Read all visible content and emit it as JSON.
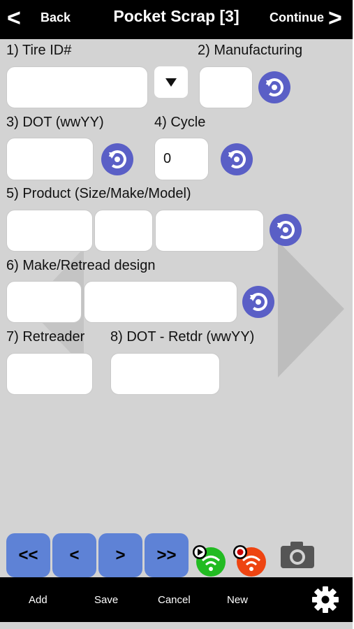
{
  "header": {
    "back_label": "Back",
    "title": "Pocket Scrap [3]",
    "continue_label": "Continue"
  },
  "form": {
    "tire_id_label": "1) Tire ID#",
    "tire_id_value": "",
    "manufacturing_label": "2) Manufacturing",
    "manufacturing_value": "",
    "dot_label": "3) DOT (wwYY)",
    "dot_value": "",
    "cycle_label": "4) Cycle",
    "cycle_value": "0",
    "product_label": "5) Product (Size/Make/Model)",
    "product_size_value": "",
    "product_make_value": "",
    "product_model_value": "",
    "retread_design_label": "6) Make/Retread design",
    "retread_make_value": "",
    "retread_design_value": "",
    "retreader_label": "7) Retreader",
    "retreader_value": "",
    "dot_retdr_label": "8) DOT - Retdr (wwYY)",
    "dot_retdr_value": ""
  },
  "nav_buttons": {
    "first": "<<",
    "prev": "<",
    "next": ">",
    "last": ">>"
  },
  "toolbar": {
    "add_label": "Add",
    "save_label": "Save",
    "cancel_label": "Cancel",
    "new_label": "New"
  },
  "colors": {
    "background": "#d3d3d3",
    "bars": "#000000",
    "reset_button": "#5a5fc6",
    "nav_button": "#5e82d6",
    "wifi_green": "#22bb22",
    "wifi_red": "#ee4411"
  },
  "icons": [
    "chevron-left-icon",
    "chevron-right-icon",
    "dropdown-arrow-icon",
    "reset-icon",
    "wifi-play-icon",
    "wifi-record-icon",
    "camera-icon",
    "gear-icon"
  ]
}
